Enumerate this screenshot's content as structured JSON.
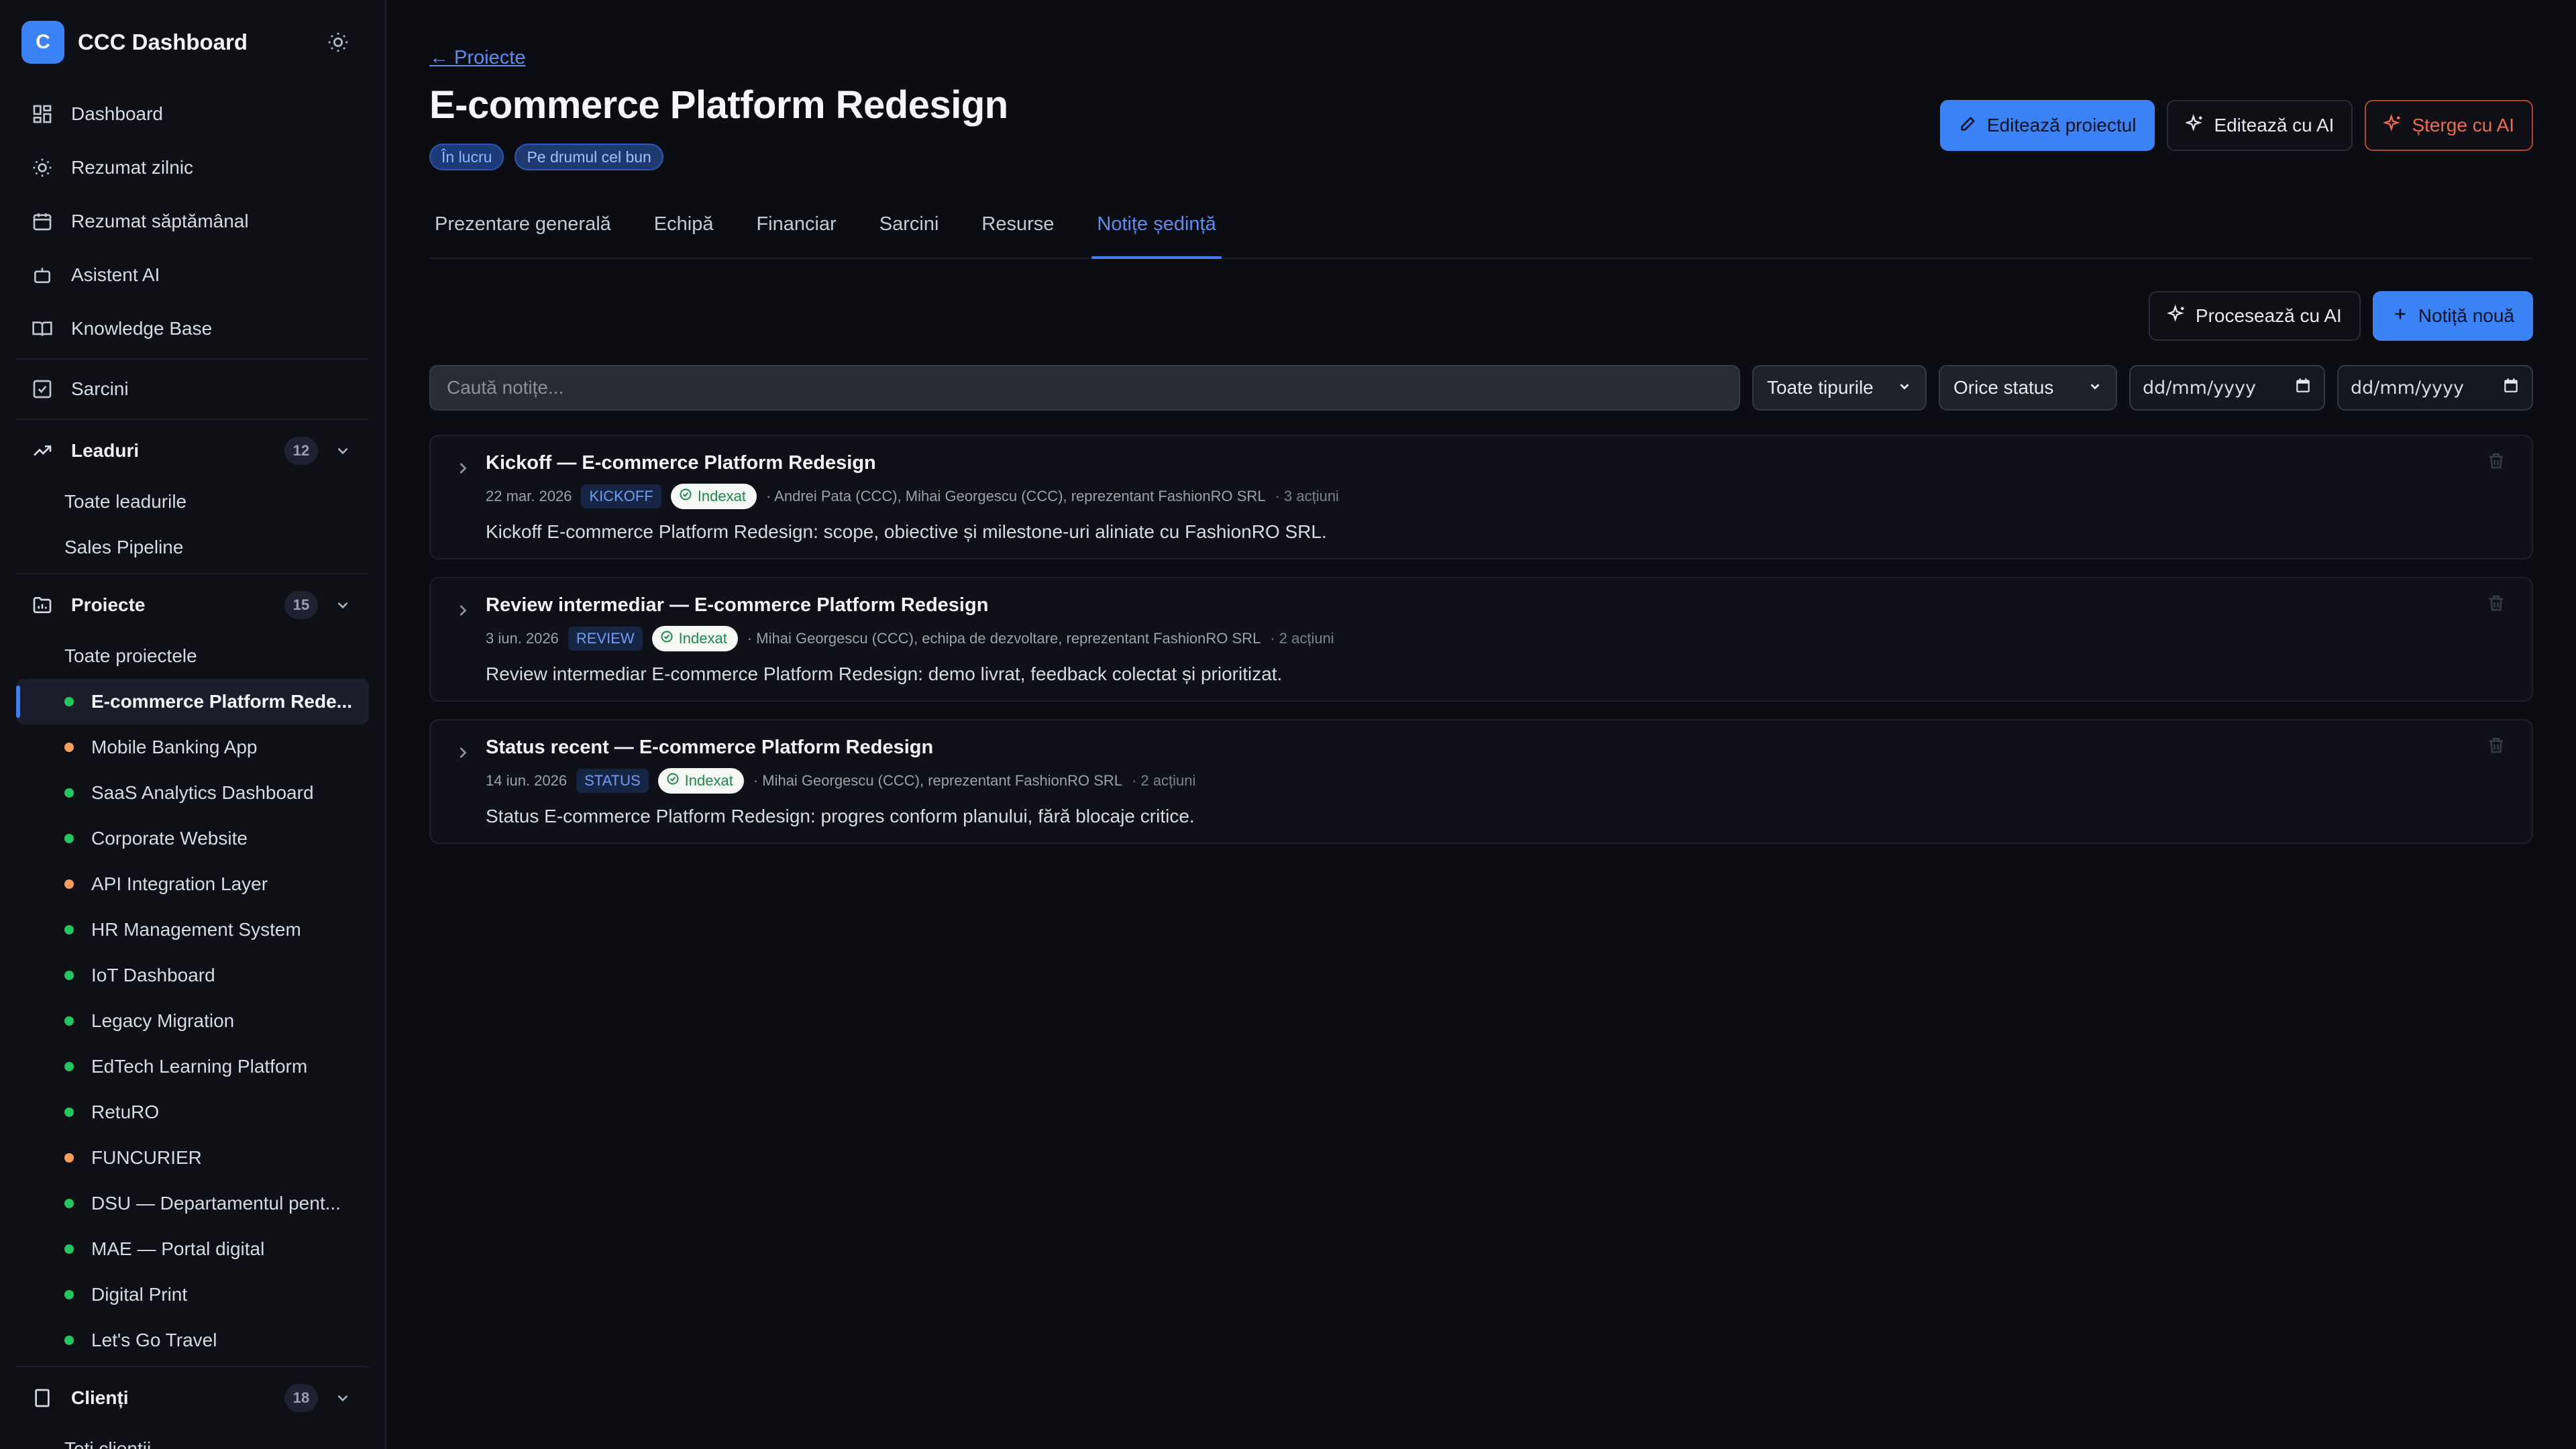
{
  "app": {
    "brand_letter": "C",
    "brand_title": "CCC Dashboard",
    "accent": "#3b82f6"
  },
  "sidebar": {
    "nav": [
      {
        "label": "Dashboard",
        "icon": "grid-icon"
      },
      {
        "label": "Rezumat zilnic",
        "icon": "sun-icon"
      },
      {
        "label": "Rezumat săptămânal",
        "icon": "calendar-icon"
      },
      {
        "label": "Asistent AI",
        "icon": "bot-icon"
      },
      {
        "label": "Knowledge Base",
        "icon": "book-icon"
      }
    ],
    "tasks_label": "Sarcini",
    "leads": {
      "label": "Leaduri",
      "count": "12",
      "items": [
        "Toate leadurile",
        "Sales Pipeline"
      ]
    },
    "projects": {
      "label": "Proiecte",
      "count": "15",
      "all_label": "Toate proiectele",
      "items": [
        {
          "label": "E-commerce Platform Rede...",
          "status": "green"
        },
        {
          "label": "Mobile Banking App",
          "status": "orange"
        },
        {
          "label": "SaaS Analytics Dashboard",
          "status": "green"
        },
        {
          "label": "Corporate Website",
          "status": "green"
        },
        {
          "label": "API Integration Layer",
          "status": "orange"
        },
        {
          "label": "HR Management System",
          "status": "green"
        },
        {
          "label": "IoT Dashboard",
          "status": "green"
        },
        {
          "label": "Legacy Migration",
          "status": "green"
        },
        {
          "label": "EdTech Learning Platform",
          "status": "green"
        },
        {
          "label": "RetuRO",
          "status": "green"
        },
        {
          "label": "FUNCURIER",
          "status": "orange"
        },
        {
          "label": "DSU — Departamentul pent...",
          "status": "green"
        },
        {
          "label": "MAE — Portal digital",
          "status": "green"
        },
        {
          "label": "Digital Print",
          "status": "green"
        },
        {
          "label": "Let's Go Travel",
          "status": "green"
        }
      ]
    },
    "clients": {
      "label": "Clienți",
      "count": "18",
      "all_label": "Toți clienții"
    },
    "status_colors": {
      "green": "#22c55e",
      "orange": "#f59e5b"
    }
  },
  "header": {
    "back_label": "← Proiecte",
    "title": "E-commerce Platform Redesign",
    "badges": [
      "În lucru",
      "Pe drumul cel bun"
    ],
    "edit_label": "Editează proiectul",
    "edit_ai_label": "Editează cu AI",
    "delete_ai_label": "Șterge cu AI"
  },
  "tabs": [
    {
      "label": "Prezentare generală",
      "active": false
    },
    {
      "label": "Echipă",
      "active": false
    },
    {
      "label": "Financiar",
      "active": false
    },
    {
      "label": "Sarcini",
      "active": false
    },
    {
      "label": "Resurse",
      "active": false
    },
    {
      "label": "Notițe ședință",
      "active": true
    }
  ],
  "toolbar": {
    "process_ai_label": "Procesează cu AI",
    "new_note_label": "Notiță nouă"
  },
  "filters": {
    "search_placeholder": "Caută notițe...",
    "type_value": "Toate tipurile",
    "status_value": "Orice status",
    "date_from": "dd/mm/yyyy",
    "date_to": "dd/mm/yyyy"
  },
  "notes": [
    {
      "title": "Kickoff — E-commerce Platform Redesign",
      "date": "22 mar. 2026",
      "type": "KICKOFF",
      "indexed": "Indexat",
      "attendees": "· Andrei Pata (CCC), Mihai Georgescu (CCC), reprezentant FashionRO SRL",
      "actions": "· 3 acțiuni",
      "summary": "Kickoff E-commerce Platform Redesign: scope, obiective și milestone-uri aliniate cu FashionRO SRL."
    },
    {
      "title": "Review intermediar — E-commerce Platform Redesign",
      "date": "3 iun. 2026",
      "type": "REVIEW",
      "indexed": "Indexat",
      "attendees": "· Mihai Georgescu (CCC), echipa de dezvoltare, reprezentant FashionRO SRL",
      "actions": "· 2 acțiuni",
      "summary": "Review intermediar E-commerce Platform Redesign: demo livrat, feedback colectat și prioritizat."
    },
    {
      "title": "Status recent — E-commerce Platform Redesign",
      "date": "14 iun. 2026",
      "type": "STATUS",
      "indexed": "Indexat",
      "attendees": "· Mihai Georgescu (CCC), reprezentant FashionRO SRL",
      "actions": "· 2 acțiuni",
      "summary": "Status E-commerce Platform Redesign: progres conform planului, fără blocaje critice."
    }
  ]
}
